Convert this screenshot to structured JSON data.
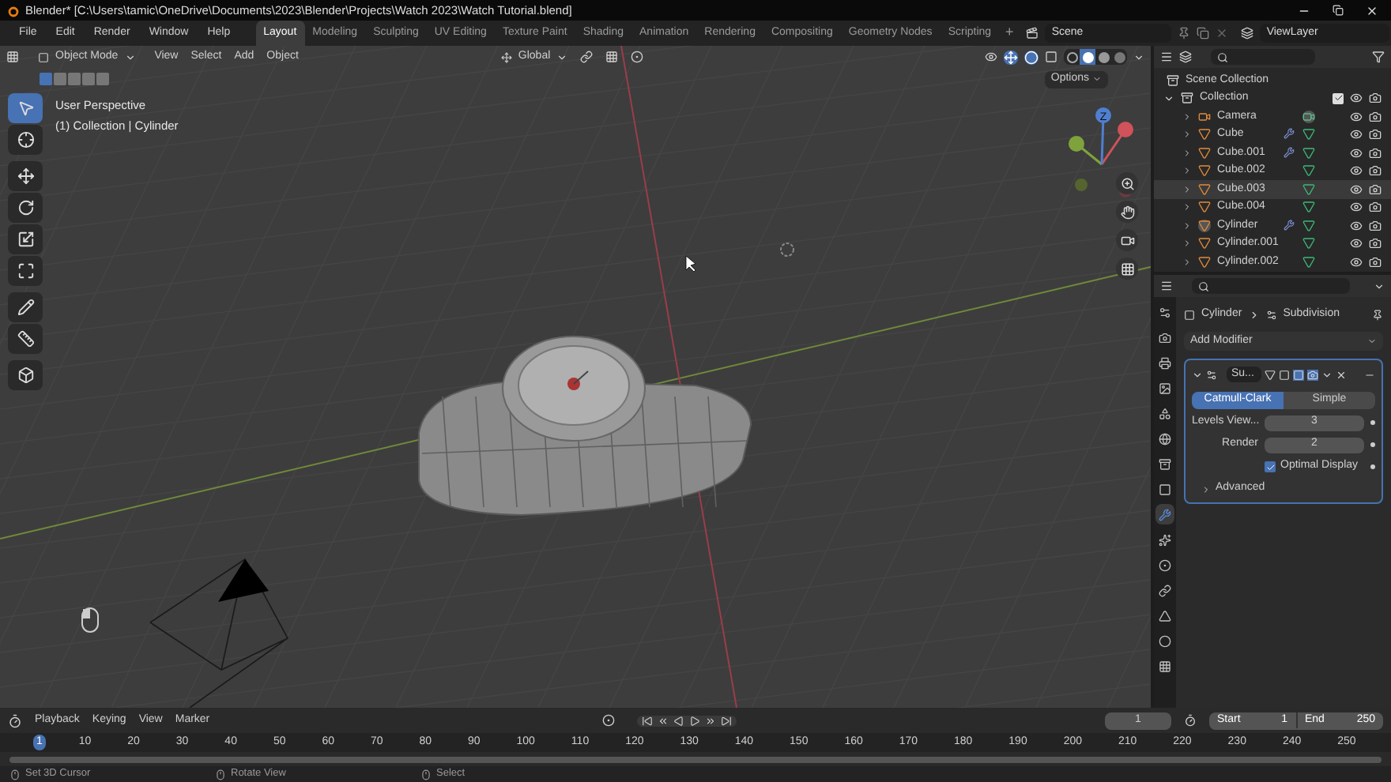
{
  "window": {
    "title": "Blender* [C:\\Users\\tamic\\OneDrive\\Documents\\2023\\Blender\\Projects\\Watch 2023\\Watch Tutorial.blend]"
  },
  "menu": [
    "File",
    "Edit",
    "Render",
    "Window",
    "Help"
  ],
  "workspaces": [
    {
      "label": "Layout",
      "selected": true
    },
    {
      "label": "Modeling",
      "selected": false
    },
    {
      "label": "Sculpting",
      "selected": false
    },
    {
      "label": "UV Editing",
      "selected": false
    },
    {
      "label": "Texture Paint",
      "selected": false
    },
    {
      "label": "Shading",
      "selected": false
    },
    {
      "label": "Animation",
      "selected": false
    },
    {
      "label": "Rendering",
      "selected": false
    },
    {
      "label": "Compositing",
      "selected": false
    },
    {
      "label": "Geometry Nodes",
      "selected": false
    },
    {
      "label": "Scripting",
      "selected": false
    }
  ],
  "add_workspace": "+",
  "scene": {
    "value": "Scene"
  },
  "view_layer": {
    "value": "ViewLayer"
  },
  "viewport": {
    "mode": "Object Mode",
    "menus": [
      "View",
      "Select",
      "Add",
      "Object"
    ],
    "orientation": "Global",
    "options": "Options",
    "overlay_lines": [
      "User Perspective",
      "(1) Collection | Cylinder"
    ],
    "select_modes": [
      {
        "selected": true
      },
      {
        "selected": false
      },
      {
        "selected": false
      },
      {
        "selected": false
      },
      {
        "selected": false
      }
    ],
    "shading": [
      {
        "kind": "wireframe",
        "selected": false
      },
      {
        "kind": "solid",
        "selected": true
      },
      {
        "kind": "material",
        "selected": false
      },
      {
        "kind": "rendered",
        "selected": false
      }
    ],
    "tools": [
      {
        "kind": "select",
        "selected": true
      },
      {
        "kind": "cursor",
        "selected": false
      },
      {
        "kind": "move",
        "selected": false
      },
      {
        "kind": "rotate",
        "selected": false
      },
      {
        "kind": "scale",
        "selected": false
      },
      {
        "kind": "transform",
        "selected": false
      },
      {
        "kind": "annotate",
        "selected": false
      },
      {
        "kind": "measure",
        "selected": false
      },
      {
        "kind": "add-cube",
        "selected": false
      }
    ],
    "gizmo_label": "Z"
  },
  "outliner": {
    "root": "Scene Collection",
    "collection": {
      "name": "Collection",
      "expanded": true,
      "checked": true,
      "children": [
        {
          "name": "Camera",
          "kind": "camera",
          "modifier": false,
          "active": false,
          "selected": false
        },
        {
          "name": "Cube",
          "kind": "mesh",
          "modifier": true,
          "active": false,
          "selected": false
        },
        {
          "name": "Cube.001",
          "kind": "mesh",
          "modifier": true,
          "active": false,
          "selected": false
        },
        {
          "name": "Cube.002",
          "kind": "mesh",
          "modifier": false,
          "active": false,
          "selected": false
        },
        {
          "name": "Cube.003",
          "kind": "mesh",
          "modifier": false,
          "active": false,
          "selected": true
        },
        {
          "name": "Cube.004",
          "kind": "mesh",
          "modifier": false,
          "active": false,
          "selected": false
        },
        {
          "name": "Cylinder",
          "kind": "mesh",
          "modifier": true,
          "active": true,
          "selected": false
        },
        {
          "name": "Cylinder.001",
          "kind": "mesh",
          "modifier": false,
          "active": false,
          "selected": false
        },
        {
          "name": "Cylinder.002",
          "kind": "mesh",
          "modifier": false,
          "active": false,
          "selected": false
        }
      ]
    }
  },
  "properties": {
    "tabs": [
      {
        "kind": "tool",
        "selected": false
      },
      {
        "kind": "render",
        "selected": false
      },
      {
        "kind": "output",
        "selected": false
      },
      {
        "kind": "view-layer",
        "selected": false
      },
      {
        "kind": "scene",
        "selected": false
      },
      {
        "kind": "world",
        "selected": false
      },
      {
        "kind": "collection",
        "selected": false
      },
      {
        "kind": "object",
        "selected": false
      },
      {
        "kind": "modifier",
        "selected": true
      },
      {
        "kind": "particles",
        "selected": false
      },
      {
        "kind": "physics",
        "selected": false
      },
      {
        "kind": "constraints",
        "selected": false
      },
      {
        "kind": "data",
        "selected": false
      },
      {
        "kind": "material",
        "selected": false
      },
      {
        "kind": "texture",
        "selected": false
      }
    ],
    "breadcrumb": [
      "Cylinder",
      "Subdivision"
    ],
    "add_modifier": "Add Modifier",
    "modifier": {
      "name": "Su...",
      "expanded": true,
      "types": [
        {
          "label": "Catmull-Clark",
          "selected": true
        },
        {
          "label": "Simple",
          "selected": false
        }
      ],
      "fields": [
        {
          "label": "Levels View...",
          "value": "3"
        },
        {
          "label": "Render",
          "value": "2"
        }
      ],
      "optimal_display": {
        "label": "Optimal Display",
        "checked": true
      },
      "advanced": {
        "label": "Advanced",
        "expanded": false
      }
    }
  },
  "timeline": {
    "menus": [
      "Playback",
      "Keying",
      "View",
      "Marker"
    ],
    "current_frame": "1",
    "start": {
      "label": "Start",
      "value": "1"
    },
    "end": {
      "label": "End",
      "value": "250"
    },
    "ticks": [
      {
        "label": "1",
        "selected": true
      },
      {
        "label": "10",
        "selected": false
      },
      {
        "label": "20",
        "selected": false
      },
      {
        "label": "30",
        "selected": false
      },
      {
        "label": "40",
        "selected": false
      },
      {
        "label": "50",
        "selected": false
      },
      {
        "label": "60",
        "selected": false
      },
      {
        "label": "70",
        "selected": false
      },
      {
        "label": "80",
        "selected": false
      },
      {
        "label": "90",
        "selected": false
      },
      {
        "label": "100",
        "selected": false
      },
      {
        "label": "110",
        "selected": false
      },
      {
        "label": "120",
        "selected": false
      },
      {
        "label": "130",
        "selected": false
      },
      {
        "label": "140",
        "selected": false
      },
      {
        "label": "150",
        "selected": false
      },
      {
        "label": "160",
        "selected": false
      },
      {
        "label": "170",
        "selected": false
      },
      {
        "label": "180",
        "selected": false
      },
      {
        "label": "190",
        "selected": false
      },
      {
        "label": "200",
        "selected": false
      },
      {
        "label": "210",
        "selected": false
      },
      {
        "label": "220",
        "selected": false
      },
      {
        "label": "230",
        "selected": false
      },
      {
        "label": "240",
        "selected": false
      },
      {
        "label": "250",
        "selected": false
      }
    ]
  },
  "status_bar": [
    {
      "label": "Set 3D Cursor"
    },
    {
      "label": "Rotate View"
    },
    {
      "label": "Select"
    }
  ]
}
